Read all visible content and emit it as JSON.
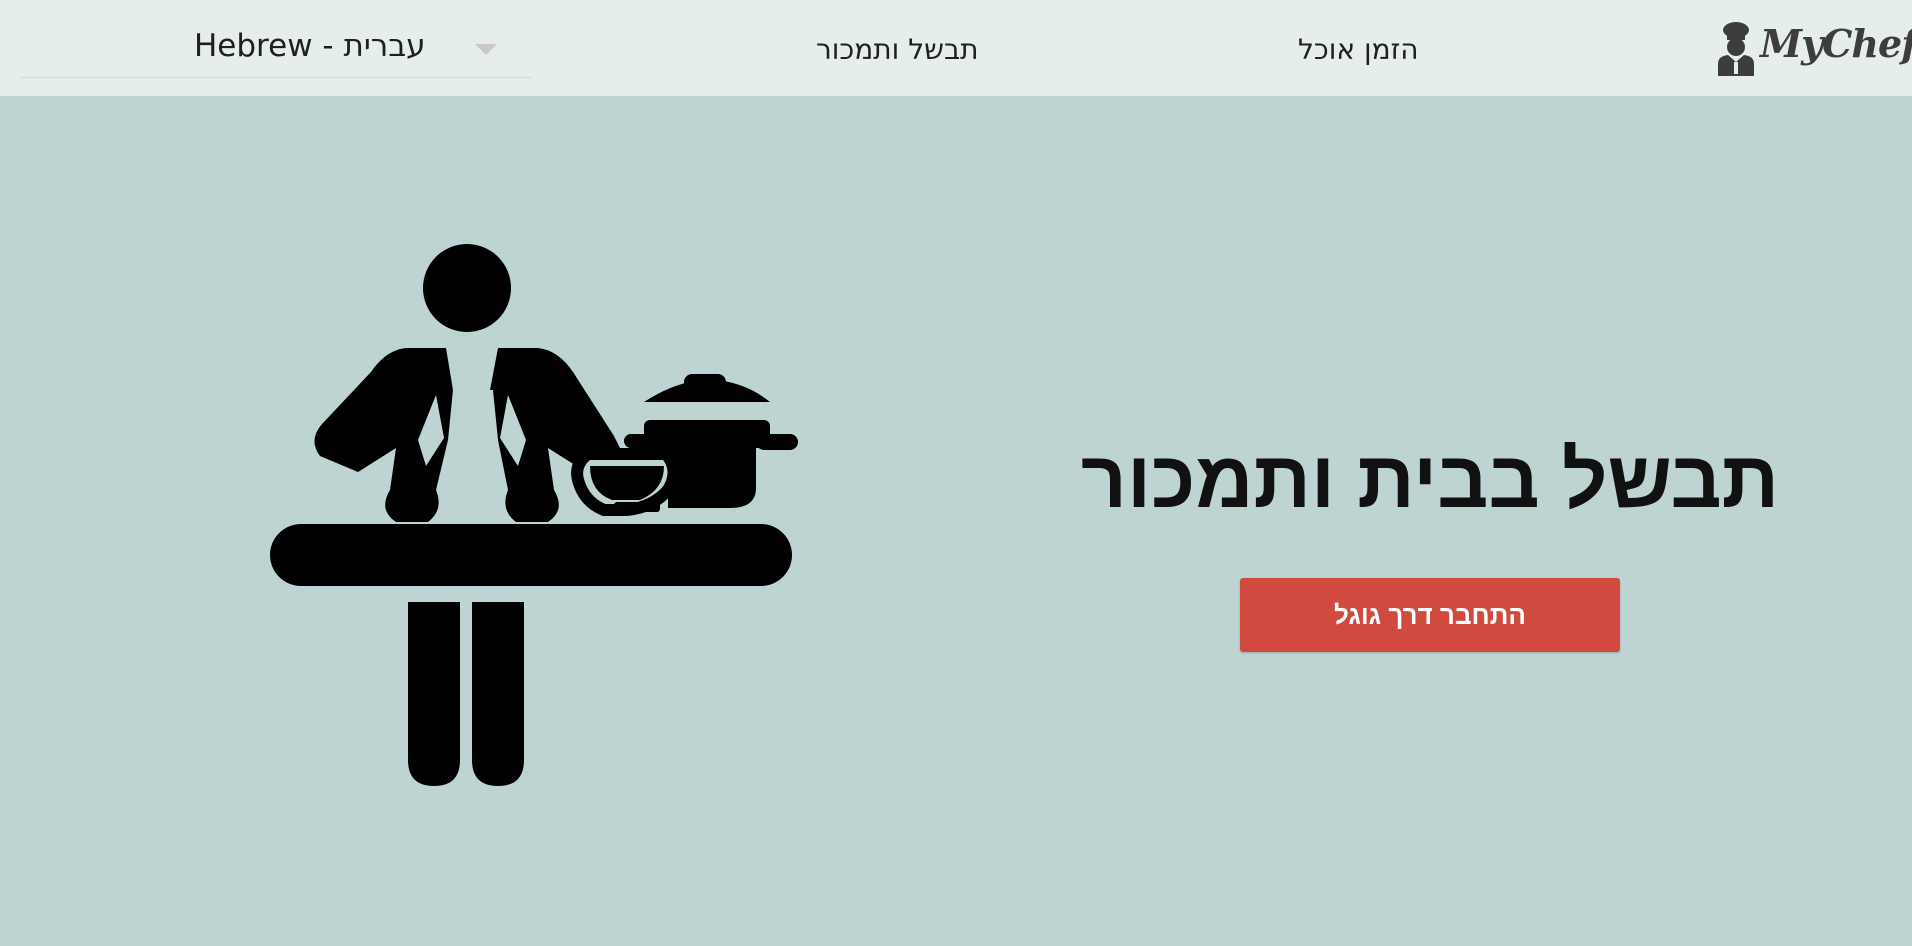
{
  "header": {
    "language_select": {
      "value": "Hebrew - עברית",
      "caret_icon": "chevron-down-icon"
    },
    "nav": {
      "cook_and_sell": "תבשל ותמכור",
      "order_food": "הזמן אוכל"
    },
    "logo": {
      "text": "MyChef",
      "icon": "chef-icon"
    }
  },
  "hero": {
    "title": "תבשל בבית ותמכור",
    "google_login_label": "התחבר דרך גוגל",
    "illustration": "cook-pictogram-icon"
  },
  "colors": {
    "background": "#bed4d2",
    "header_background": "#e5eded",
    "button": "#d14a3f",
    "text": "#111111"
  }
}
